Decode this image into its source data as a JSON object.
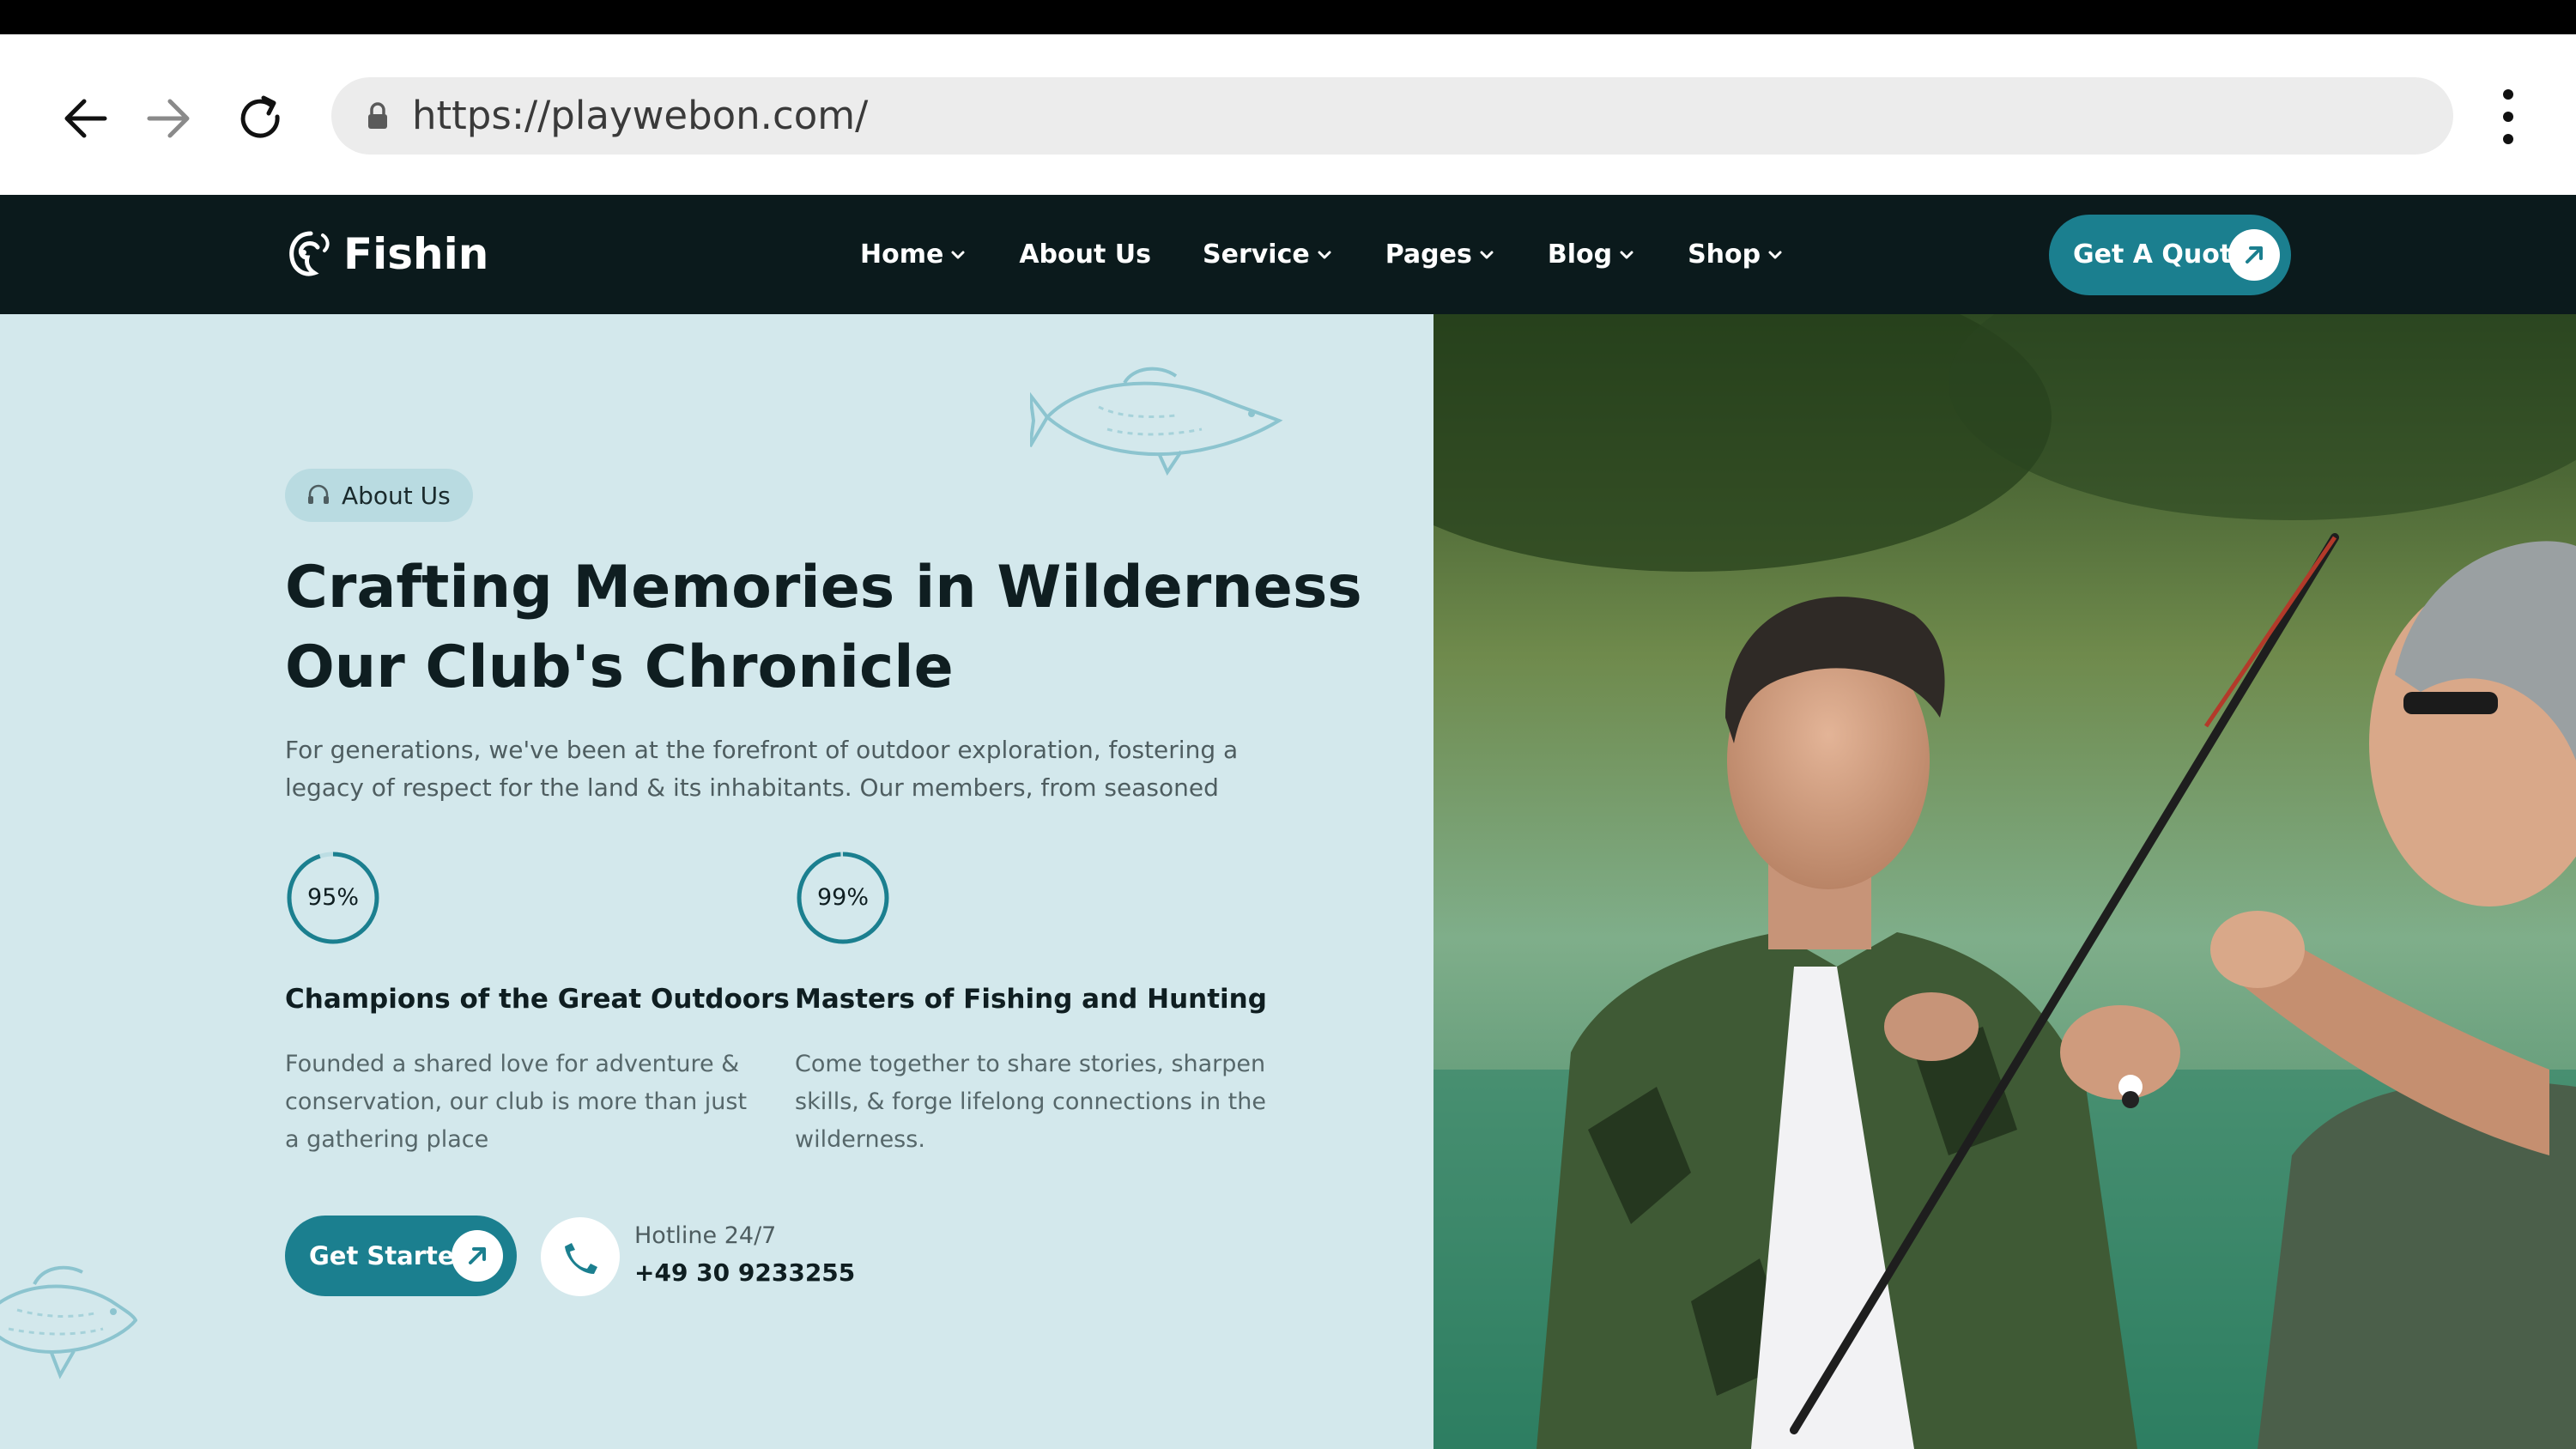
{
  "browser": {
    "url": "https://playwebon.com/",
    "icons": [
      "back-arrow-icon",
      "forward-arrow-icon",
      "reload-icon",
      "lock-icon",
      "more-vert-icon"
    ]
  },
  "header": {
    "logo_text": "Fishin",
    "nav": [
      {
        "label": "Home",
        "has_dropdown": true
      },
      {
        "label": "About Us",
        "has_dropdown": false
      },
      {
        "label": "Service",
        "has_dropdown": true
      },
      {
        "label": "Pages",
        "has_dropdown": true
      },
      {
        "label": "Blog",
        "has_dropdown": true
      },
      {
        "label": "Shop",
        "has_dropdown": true
      }
    ],
    "cta_label": "Get A Quote"
  },
  "about": {
    "badge": "About Us",
    "title_line1": "Crafting Memories in Wilderness",
    "title_line2": "Our Club's Chronicle",
    "description": "For generations, we've been at the forefront of outdoor exploration, fostering a legacy of respect for the land & its inhabitants. Our members, from seasoned",
    "stats": [
      {
        "value": "95%",
        "percent": 95,
        "title": "Champions of the Great Outdoors",
        "text": "Founded a shared love for adventure & conservation, our club is more than just a gathering place"
      },
      {
        "value": "99%",
        "percent": 99,
        "title": "Masters of Fishing and Hunting",
        "text": "Come together to share stories, sharpen skills, & forge lifelong connections in the wilderness."
      }
    ],
    "cta_label": "Get Started",
    "hotline_label": "Hotline 24/7",
    "hotline_number": "+49 30 9233255"
  },
  "colors": {
    "accent": "#1b7f8f",
    "header_bg": "#0b1a1c",
    "panel_bg": "#d3e8ec",
    "badge_bg": "#b9dbe1",
    "heading": "#0f1e21",
    "body_text": "#4e5d60"
  }
}
